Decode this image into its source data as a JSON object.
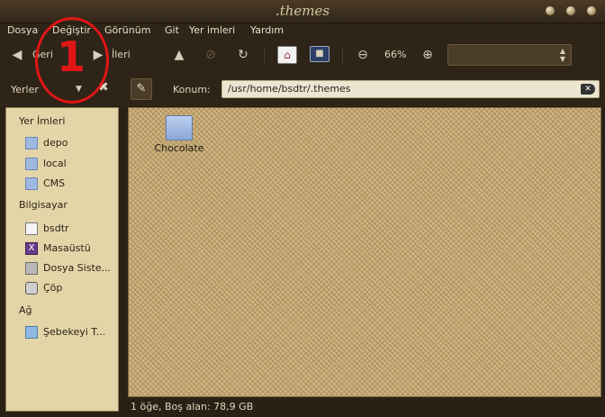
{
  "window": {
    "title": ".themes"
  },
  "menu": [
    "Dosya",
    "Değiştir",
    "Görünüm",
    "Git",
    "Yer imleri",
    "Yardım"
  ],
  "toolbar": {
    "back_label": "Geri",
    "forward_label": "İleri",
    "zoom_level": "66%",
    "zoom_mode_value": ""
  },
  "location": {
    "places_label": "Yerler",
    "konum_label": "Konum:",
    "path": "/usr/home/bsdtr/.themes"
  },
  "sidebar": {
    "sections": [
      {
        "title": "Yer İmleri",
        "items": [
          {
            "label": "depo",
            "icon": "folder-icon"
          },
          {
            "label": "local",
            "icon": "folder-icon"
          },
          {
            "label": "CMS",
            "icon": "folder-icon"
          }
        ]
      },
      {
        "title": "Bilgisayar",
        "items": [
          {
            "label": "bsdtr",
            "icon": "home-icon"
          },
          {
            "label": "Masaüstü",
            "icon": "desktop-icon"
          },
          {
            "label": "Dosya Siste...",
            "icon": "drive-icon"
          },
          {
            "label": "Çöp",
            "icon": "trash-icon"
          }
        ]
      },
      {
        "title": "Ağ",
        "items": [
          {
            "label": "Şebekeyi T...",
            "icon": "network-icon"
          }
        ]
      }
    ]
  },
  "files": [
    {
      "name": "Chocolate",
      "icon": "folder-icon"
    }
  ],
  "status": {
    "text": "1 öğe, Boş alan: 78,9 GB"
  },
  "annotation": {
    "number": "1",
    "color": "#e01616"
  },
  "colors": {
    "accent": "#c9ad78",
    "sidebar_bg": "#e3d5a8",
    "chrome_bg": "#2e2418"
  }
}
